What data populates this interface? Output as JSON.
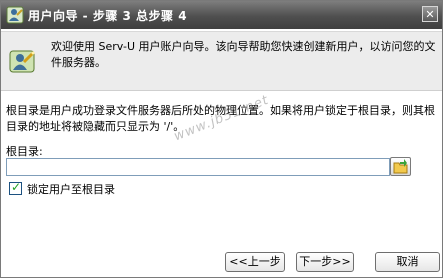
{
  "window": {
    "title": "用户向导 - 步骤 3 总步骤 4",
    "close_glyph": "✕"
  },
  "header": {
    "welcome_text": "欢迎使用 Serv-U 用户账户向导。该向导帮助您快速创建新用户，以访问您的文件服务器。"
  },
  "body": {
    "description": "根目录是用户成功登录文件服务器后所处的物理位置。如果将用户锁定于根目录，则其根目录的地址将被隐藏而只显示为 '/'。",
    "root_label": "根目录:",
    "root_value": "",
    "lock_label": "锁定用户至根目录",
    "lock_checked": true
  },
  "buttons": {
    "back": "<<上一步",
    "next": "下一步>>",
    "cancel": "取消"
  },
  "watermark": "www.jb51.net",
  "colors": {
    "titlebar": "#4f4f4f",
    "header_bg": "#ececec",
    "check": "#21a121"
  },
  "icons": {
    "title": "wizard-user-icon",
    "header": "wizard-user-icon",
    "browse": "folder-icon"
  }
}
